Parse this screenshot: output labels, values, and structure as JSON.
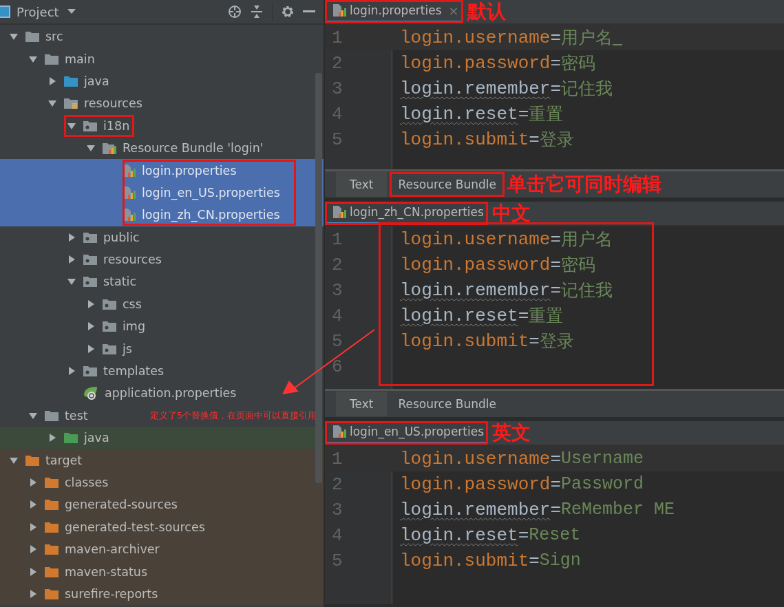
{
  "project_panel": {
    "title": "Project",
    "tree": [
      {
        "name": "src",
        "kind": "folder",
        "expanded": true,
        "selected": false,
        "children": [
          {
            "name": "main",
            "kind": "folder",
            "expanded": true,
            "selected": false,
            "children": [
              {
                "name": "java",
                "kind": "source",
                "expanded": false,
                "selected": false
              },
              {
                "name": "resources",
                "kind": "resources",
                "expanded": true,
                "selected": false,
                "children": [
                  {
                    "name": "i18n",
                    "kind": "package",
                    "expanded": true,
                    "selected": false,
                    "outlined": true,
                    "children": [
                      {
                        "name": "Resource Bundle 'login'",
                        "kind": "bundle",
                        "expanded": true,
                        "selected": false,
                        "children_outlined": true,
                        "children": [
                          {
                            "name": "login.properties",
                            "kind": "properties",
                            "selected": true
                          },
                          {
                            "name": "login_en_US.properties",
                            "kind": "properties",
                            "selected": true
                          },
                          {
                            "name": "login_zh_CN.properties",
                            "kind": "properties",
                            "selected": true
                          }
                        ]
                      }
                    ]
                  },
                  {
                    "name": "public",
                    "kind": "package",
                    "expanded": false,
                    "selected": false
                  },
                  {
                    "name": "resources",
                    "kind": "package",
                    "expanded": false,
                    "selected": false
                  },
                  {
                    "name": "static",
                    "kind": "package",
                    "expanded": true,
                    "selected": false,
                    "children": [
                      {
                        "name": "css",
                        "kind": "package",
                        "expanded": false,
                        "selected": false
                      },
                      {
                        "name": "img",
                        "kind": "package",
                        "expanded": false,
                        "selected": false
                      },
                      {
                        "name": "js",
                        "kind": "package",
                        "expanded": false,
                        "selected": false
                      }
                    ]
                  },
                  {
                    "name": "templates",
                    "kind": "package",
                    "expanded": false,
                    "selected": false
                  },
                  {
                    "name": "application.properties",
                    "kind": "spring",
                    "selected": false
                  }
                ]
              }
            ]
          },
          {
            "name": "test",
            "kind": "folder",
            "expanded": true,
            "selected": false,
            "note": "定义了5个替换值，在页面中可以直接引用",
            "children": [
              {
                "name": "java",
                "kind": "test-source",
                "expanded": false,
                "selected": false
              }
            ]
          }
        ]
      },
      {
        "name": "target",
        "kind": "excluded",
        "expanded": true,
        "selected": false,
        "children": [
          {
            "name": "classes",
            "kind": "excluded",
            "expanded": false,
            "selected": false
          },
          {
            "name": "generated-sources",
            "kind": "excluded",
            "expanded": false,
            "selected": false
          },
          {
            "name": "generated-test-sources",
            "kind": "excluded",
            "expanded": false,
            "selected": false
          },
          {
            "name": "maven-archiver",
            "kind": "excluded",
            "expanded": false,
            "selected": false
          },
          {
            "name": "maven-status",
            "kind": "excluded",
            "expanded": false,
            "selected": false
          },
          {
            "name": "surefire-reports",
            "kind": "excluded",
            "expanded": false,
            "selected": false
          }
        ]
      }
    ]
  },
  "editors": [
    {
      "file": {
        "label": "login.properties",
        "close": "×",
        "outlined": true
      },
      "note": "默认",
      "code_outlined": false,
      "lines": [
        {
          "number": "1",
          "key": "login.username",
          "separator": "=",
          "value": "用户名",
          "unused": false,
          "current": true,
          "caret": true
        },
        {
          "number": "2",
          "key": "login.password",
          "separator": "=",
          "value": "密码",
          "unused": false,
          "current": false,
          "caret": false
        },
        {
          "number": "3",
          "key": "login.remember",
          "separator": "=",
          "value": "记住我",
          "unused": true,
          "current": false,
          "caret": false
        },
        {
          "number": "4",
          "key": "login.reset",
          "separator": "=",
          "value": "重置",
          "unused": true,
          "current": false,
          "caret": false
        },
        {
          "number": "5",
          "key": "login.submit",
          "separator": "=",
          "value": "登录",
          "unused": false,
          "current": false,
          "caret": false
        }
      ],
      "view_tabs": [
        {
          "label": "Text",
          "selected": true,
          "outlined": false
        },
        {
          "label": "Resource Bundle",
          "selected": false,
          "outlined": true
        }
      ],
      "view_note": "单击它可同时编辑"
    },
    {
      "file": {
        "label": "login_zh_CN.properties",
        "outlined": true
      },
      "note": "中文",
      "code_outlined": true,
      "lines": [
        {
          "number": "1",
          "key": "login.username",
          "separator": "=",
          "value": "用户名",
          "unused": false,
          "current": false,
          "caret": false
        },
        {
          "number": "2",
          "key": "login.password",
          "separator": "=",
          "value": "密码",
          "unused": false,
          "current": false,
          "caret": false
        },
        {
          "number": "3",
          "key": "login.remember",
          "separator": "=",
          "value": "记住我",
          "unused": true,
          "current": false,
          "caret": false
        },
        {
          "number": "4",
          "key": "login.reset",
          "separator": "=",
          "value": "重置",
          "unused": true,
          "current": false,
          "caret": false
        },
        {
          "number": "5",
          "key": "login.submit",
          "separator": "=",
          "value": "登录",
          "unused": false,
          "current": false,
          "caret": false
        },
        {
          "number": "6"
        }
      ],
      "view_tabs": [
        {
          "label": "Text",
          "selected": true,
          "outlined": false
        },
        {
          "label": "Resource Bundle",
          "selected": false,
          "outlined": false
        }
      ]
    },
    {
      "file": {
        "label": "login_en_US.properties",
        "outlined": true
      },
      "note": "英文",
      "code_outlined": false,
      "lines": [
        {
          "number": "1",
          "key": "login.username",
          "separator": "=",
          "value": "Username",
          "unused": false,
          "current": true,
          "caret": false
        },
        {
          "number": "2",
          "key": "login.password",
          "separator": "=",
          "value": "Password",
          "unused": false,
          "current": false,
          "caret": false
        },
        {
          "number": "3",
          "key": "login.remember",
          "separator": "=",
          "value": "ReMember ME",
          "unused": true,
          "current": false,
          "caret": false
        },
        {
          "number": "4",
          "key": "login.reset",
          "separator": "=",
          "value": "Reset",
          "unused": true,
          "current": false,
          "caret": false
        },
        {
          "number": "5",
          "key": "login.submit",
          "separator": "=",
          "value": "Sign",
          "unused": false,
          "current": false,
          "caret": false
        }
      ]
    }
  ]
}
